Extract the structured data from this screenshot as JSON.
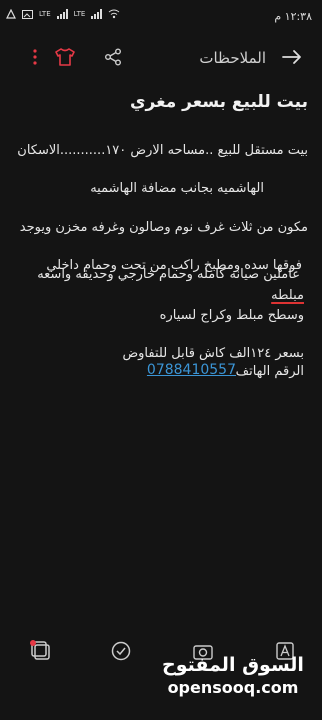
{
  "status_bar": {
    "time": "١٢:٣٨ م",
    "network_labels": [
      "LTE",
      "LTE"
    ]
  },
  "app_bar": {
    "title": "الملاحظات"
  },
  "note": {
    "title": "بيت للبيع بسعر مغري",
    "lines": [
      "بيت مستقل للبيع ..مساحه الارض ١٧٠...........الاسكان",
      "الهاشميه بجانب مضافة الهاشميه",
      "مكون من ثلاث غرف نوم  وصالون وغرفه مخزن ويوجد",
      "فوقها سده  ومطبخ راكب من تحت وحمام داخلي",
      "عاملين صيانه كامله  وحمام خارجي وحديقه واسعه",
      "مبلطه",
      "وسطح مبلط وكراج لسياره",
      "بسعر ١٢٤الف  كاش قابل للتفاوض",
      "الرقم الهاتف"
    ],
    "phone": "0788410557"
  },
  "watermark": {
    "arabic": "السوق المفتوح",
    "latin": "opensooq.com"
  },
  "colors": {
    "background": "#141414",
    "link": "#3b95d6",
    "spell_underline": "#d33333"
  }
}
